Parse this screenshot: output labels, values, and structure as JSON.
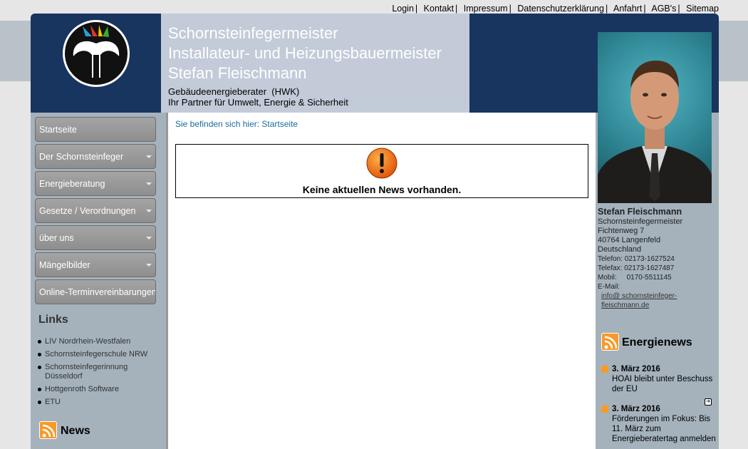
{
  "topnav": [
    {
      "label": "Login"
    },
    {
      "label": "Kontakt"
    },
    {
      "label": "Impressum"
    },
    {
      "label": "Datenschutzerklärung"
    },
    {
      "label": "Anfahrt"
    },
    {
      "label": "AGB's"
    },
    {
      "label": "Sitemap"
    }
  ],
  "header": {
    "line1": "Schornsteinfegermeister",
    "line2": "Installateur- und Heizungsbauermeister",
    "line3": "Stefan Fleischmann",
    "sub1": "Gebäudeenergieberater  (HWK)",
    "sub2": "Ihr Partner für Umwelt, Energie & Sicherheit"
  },
  "nav": [
    {
      "label": "Startseite",
      "dropdown": false
    },
    {
      "label": "Der Schornsteinfeger",
      "dropdown": true
    },
    {
      "label": "Energieberatung",
      "dropdown": true
    },
    {
      "label": "Gesetze / Verordnungen",
      "dropdown": true
    },
    {
      "label": "über uns",
      "dropdown": true
    },
    {
      "label": "Mängelbilder",
      "dropdown": true
    },
    {
      "label": "Online-Terminvereinbarungen",
      "dropdown": false
    }
  ],
  "links": {
    "heading": "Links",
    "items": [
      "LIV Nordrhein-Westfalen",
      "Schornsteinfegerschule NRW",
      "Schornsteinfegerinnung Düsseldorf",
      "Hottgenroth Software",
      "ETU"
    ]
  },
  "news": {
    "heading": "News"
  },
  "main": {
    "breadcrumb": "Sie befinden sich hier: Startseite",
    "message": "Keine aktuellen News vorhanden."
  },
  "contact": {
    "name": "Stefan Fleischmann",
    "role": "Schornsteinfegermeister",
    "street": "Fichtenweg 7",
    "city": "40764 Langenfeld",
    "country": "Deutschland",
    "phone": "Telefon: 02173-1627524",
    "fax": "Telefax: 02173-1627487",
    "mobile": "Mobil:     0170-5511145",
    "email_label": "E-Mail:",
    "email": "info@ schornsteinfeger-fleischmann.de"
  },
  "energienews": {
    "heading": "Energienews",
    "items": [
      {
        "date": "3. März 2016",
        "text": "HOAI bleibt unter Beschuss der EU"
      },
      {
        "date": "3. März 2016",
        "text": "Förderungen im Fokus: Bis 11. März zum Energieberatertag anmelden"
      }
    ]
  },
  "colors": {
    "header_blue": "#18355f",
    "side_gray": "#a5b2bc",
    "rss_orange": "#f89a2a",
    "link_blue": "#1a6c9a"
  },
  "icons": {
    "logo": "chimney-sweep-guild-logo",
    "warning": "warning-icon",
    "rss": "rss-icon"
  }
}
